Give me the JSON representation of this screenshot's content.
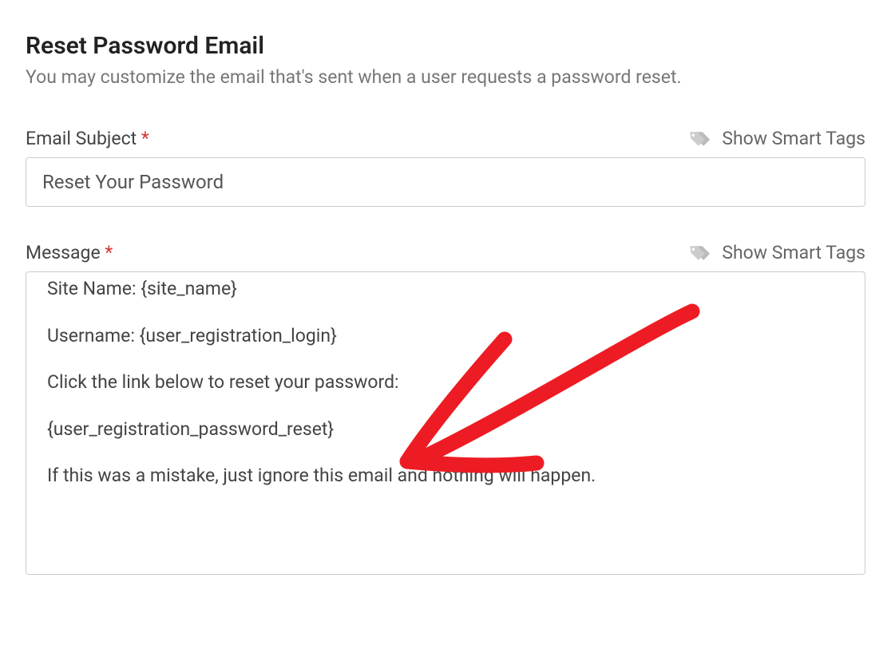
{
  "section": {
    "title": "Reset Password Email",
    "description": "You may customize the email that's sent when a user requests a password reset."
  },
  "subject": {
    "label": "Email Subject",
    "required_marker": "*",
    "smart_tags_label": "Show Smart Tags",
    "value": "Reset Your Password"
  },
  "message": {
    "label": "Message",
    "required_marker": "*",
    "smart_tags_label": "Show Smart Tags",
    "lines": {
      "l0": "Site Name: {site_name}",
      "l1": "Username: {user_registration_login}",
      "l2": "Click the link below to reset your password:",
      "l3": "{user_registration_password_reset}",
      "l4": "If this was a mistake, just ignore this email and nothing will happen."
    }
  },
  "annotation": {
    "color": "#ed1c24",
    "type": "hand-drawn-arrow"
  }
}
